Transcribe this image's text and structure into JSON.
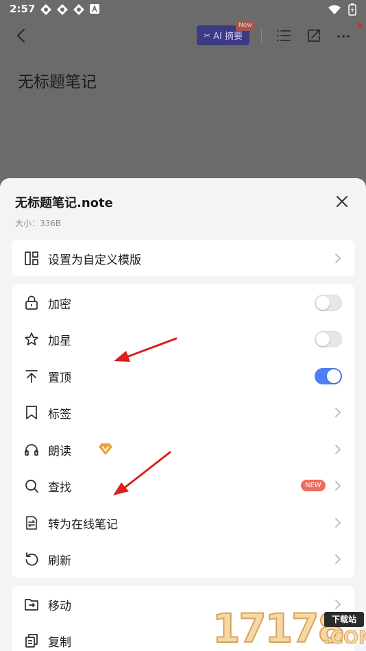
{
  "status_bar": {
    "time": "2:57"
  },
  "top_bar": {
    "ai_label": "AI 摘要",
    "ai_icon": "✂",
    "new_badge": "New"
  },
  "background": {
    "note_title": "无标题笔记"
  },
  "sheet": {
    "title": "无标题笔记.note",
    "size": "大小：336B",
    "group1": [
      {
        "label": "设置为自定义模版",
        "icon": "template-icon"
      }
    ],
    "group2": [
      {
        "label": "加密",
        "icon": "lock-icon",
        "toggle": false
      },
      {
        "label": "加星",
        "icon": "star-icon",
        "toggle": false
      },
      {
        "label": "置顶",
        "icon": "pin-top-icon",
        "toggle": true
      },
      {
        "label": "标签",
        "icon": "bookmark-icon"
      },
      {
        "label": "朗读",
        "icon": "headphones-icon",
        "vip": true
      },
      {
        "label": "查找",
        "icon": "search-icon",
        "new_tag": "NEW"
      },
      {
        "label": "转为在线笔记",
        "icon": "convert-doc-icon"
      },
      {
        "label": "刷新",
        "icon": "refresh-icon"
      }
    ],
    "group3": [
      {
        "label": "移动",
        "icon": "move-icon"
      },
      {
        "label": "复制",
        "icon": "copy-icon"
      }
    ]
  },
  "watermark": {
    "digits": "17178",
    "tag": "下载站",
    "com": ".COM"
  },
  "colors": {
    "accent": "#4f7ef0",
    "new_tag": "#f06a60",
    "arrow": "#d91f1f",
    "vip": "#f0a030"
  }
}
